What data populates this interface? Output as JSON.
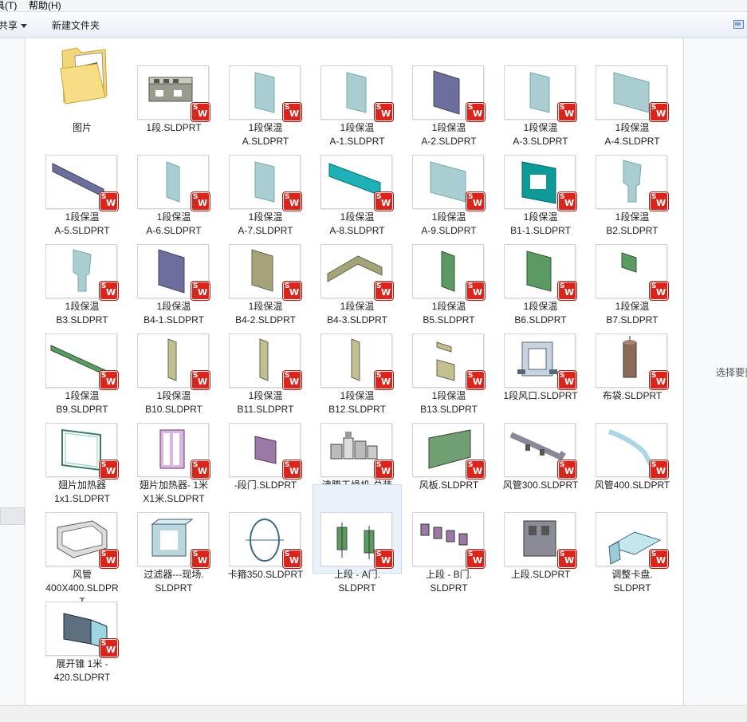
{
  "menu": {
    "tools": "具(T)",
    "help": "帮助(H)"
  },
  "toolbar": {
    "share": "共享",
    "new_folder": "新建文件夹"
  },
  "preview": {
    "text": "选择要预"
  },
  "items": [
    {
      "name": "图片",
      "l1": "图片",
      "l2": "",
      "l3": "",
      "kind": "folder"
    },
    {
      "name": "1段.SLDPRT",
      "l1": "1段.SLDPRT",
      "l2": "",
      "l3": "",
      "kind": "box"
    },
    {
      "name": "1段保温 A.SLDPRT",
      "l1": "1段保温",
      "l2": "A.SLDPRT",
      "l3": "",
      "kind": "panel-lt"
    },
    {
      "name": "1段保温 A-1.SLDPRT",
      "l1": "1段保温",
      "l2": "A-1.SLDPRT",
      "l3": "",
      "kind": "panel-lt"
    },
    {
      "name": "1段保温 A-2.SLDPRT",
      "l1": "1段保温",
      "l2": "A-2.SLDPRT",
      "l3": "",
      "kind": "panel-dk"
    },
    {
      "name": "1段保温 A-3.SLDPRT",
      "l1": "1段保温",
      "l2": "A-3.SLDPRT",
      "l3": "",
      "kind": "panel-lt"
    },
    {
      "name": "1段保温 A-4.SLDPRT",
      "l1": "1段保温",
      "l2": "A-4.SLDPRT",
      "l3": "",
      "kind": "panel-wide"
    },
    {
      "name": "1段保温 A-5.SLDPRT",
      "l1": "1段保温",
      "l2": "A-5.SLDPRT",
      "l3": "",
      "kind": "bar-dk"
    },
    {
      "name": "1段保温 A-6.SLDPRT",
      "l1": "1段保温",
      "l2": "A-6.SLDPRT",
      "l3": "",
      "kind": "panel-thin"
    },
    {
      "name": "1段保温 A-7.SLDPRT",
      "l1": "1段保温",
      "l2": "A-7.SLDPRT",
      "l3": "",
      "kind": "panel-lt"
    },
    {
      "name": "1段保温 A-8.SLDPRT",
      "l1": "1段保温",
      "l2": "A-8.SLDPRT",
      "l3": "",
      "kind": "bar-cyan"
    },
    {
      "name": "1段保温 A-9.SLDPRT",
      "l1": "1段保温",
      "l2": "A-9.SLDPRT",
      "l3": "",
      "kind": "panel-wide"
    },
    {
      "name": "1段保温 B1-1.SLDPRT",
      "l1": "1段保温",
      "l2": "B1-1.SLDPRT",
      "l3": "",
      "kind": "frame-teal"
    },
    {
      "name": "1段保温 B2.SLDPRT",
      "l1": "1段保温",
      "l2": "B2.SLDPRT",
      "l3": "",
      "kind": "key"
    },
    {
      "name": "1段保温 B3.SLDPRT",
      "l1": "1段保温",
      "l2": "B3.SLDPRT",
      "l3": "",
      "kind": "key"
    },
    {
      "name": "1段保温 B4-1.SLDPRT",
      "l1": "1段保温",
      "l2": "B4-1.SLDPRT",
      "l3": "",
      "kind": "panel-dk"
    },
    {
      "name": "1段保温 B4-2.SLDPRT",
      "l1": "1段保温",
      "l2": "B4-2.SLDPRT",
      "l3": "",
      "kind": "panel-olive"
    },
    {
      "name": "1段保温 B4-3.SLDPRT",
      "l1": "1段保温",
      "l2": "B4-3.SLDPRT",
      "l3": "",
      "kind": "bent-olive"
    },
    {
      "name": "1段保温 B5.SLDPRT",
      "l1": "1段保温",
      "l2": "B5.SLDPRT",
      "l3": "",
      "kind": "panel-green-thin"
    },
    {
      "name": "1段保温 B6.SLDPRT",
      "l1": "1段保温",
      "l2": "B6.SLDPRT",
      "l3": "",
      "kind": "panel-green"
    },
    {
      "name": "1段保温 B7.SLDPRT",
      "l1": "1段保温",
      "l2": "B7.SLDPRT",
      "l3": "",
      "kind": "panel-green-small"
    },
    {
      "name": "1段保温 B9.SLDPRT",
      "l1": "1段保温",
      "l2": "B9.SLDPRT",
      "l3": "",
      "kind": "bar-green"
    },
    {
      "name": "1段保温 B10.SLDPRT",
      "l1": "1段保温",
      "l2": "B10.SLDPRT",
      "l3": "",
      "kind": "strip-olive"
    },
    {
      "name": "1段保温 B11.SLDPRT",
      "l1": "1段保温",
      "l2": "B11.SLDPRT",
      "l3": "",
      "kind": "strip-olive"
    },
    {
      "name": "1段保温 B12.SLDPRT",
      "l1": "1段保温",
      "l2": "B12.SLDPRT",
      "l3": "",
      "kind": "strip-olive"
    },
    {
      "name": "1段保温 B13.SLDPRT",
      "l1": "1段保温",
      "l2": "B13.SLDPRT",
      "l3": "",
      "kind": "two-olive"
    },
    {
      "name": "1段风口.SLDPRT",
      "l1": "1段风口.SLDPRT",
      "l2": "",
      "l3": "",
      "kind": "vent"
    },
    {
      "name": "布袋.SLDPRT",
      "l1": "布袋.SLDPRT",
      "l2": "",
      "l3": "",
      "kind": "cylinder"
    },
    {
      "name": "翅片加热器 1x1.SLDPRT",
      "l1": "翅片加热器",
      "l2": "1x1.SLDPRT",
      "l3": "",
      "kind": "frame-line"
    },
    {
      "name": "翅片加热器- 1米X1米.SLDPRT",
      "l1": "翅片加热器- 1米",
      "l2": "X1米.SLDPRT",
      "l3": "",
      "kind": "frame-purple"
    },
    {
      "name": "-段门.SLDPRT",
      "l1": "-段门.SLDPRT",
      "l2": "",
      "l3": "",
      "kind": "door-purple"
    },
    {
      "name": "沸腾干燥机-总装图.SLDASM",
      "l1": "沸腾干燥机-总装",
      "l2": "图.SLDASM",
      "l3": "",
      "kind": "assembly"
    },
    {
      "name": "风板.SLDPRT",
      "l1": "风板.SLDPRT",
      "l2": "",
      "l3": "",
      "kind": "board-green"
    },
    {
      "name": "风管300.SLDPRT",
      "l1": "风管300.SLDPRT",
      "l2": "",
      "l3": "",
      "kind": "pipe-gray"
    },
    {
      "name": "风管400.SLDPRT",
      "l1": "风管400.SLDPRT",
      "l2": "",
      "l3": "",
      "kind": "pipe-cyan"
    },
    {
      "name": "风管 400X400.SLDPRT",
      "l1": "风管",
      "l2": "400X400.SLDPR",
      "l3": "T",
      "kind": "duct"
    },
    {
      "name": "过滤器---现场.SLDPRT",
      "l1": "过滤器---现场.",
      "l2": "SLDPRT",
      "l3": "",
      "kind": "filter"
    },
    {
      "name": "卡箍350.SLDPRT",
      "l1": "卡箍350.SLDPRT",
      "l2": "",
      "l3": "",
      "kind": "ring"
    },
    {
      "name": "上段 - A门.SLDPRT",
      "l1": "上段 - A门.",
      "l2": "SLDPRT",
      "l3": "",
      "kind": "doors-green",
      "selected": true
    },
    {
      "name": "上段 - B门.SLDPRT",
      "l1": "上段 - B门.",
      "l2": "SLDPRT",
      "l3": "",
      "kind": "doors-purple"
    },
    {
      "name": "上段.SLDPRT",
      "l1": "上段.SLDPRT",
      "l2": "",
      "l3": "",
      "kind": "block-gray"
    },
    {
      "name": "调整卡盘.SLDPRT",
      "l1": "调整卡盘.",
      "l2": "SLDPRT",
      "l3": "",
      "kind": "plate-cyan"
    },
    {
      "name": "展开锥 1米 - 420.SLDPRT",
      "l1": "展开锥 1米 -",
      "l2": "420.SLDPRT",
      "l3": "",
      "kind": "cone"
    }
  ]
}
